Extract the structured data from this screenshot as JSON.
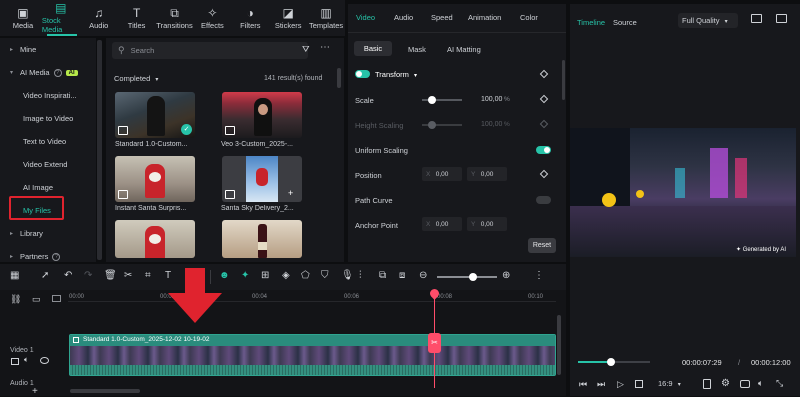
{
  "top_tabs": [
    {
      "label": "Media",
      "icon": "media-icon"
    },
    {
      "label": "Stock Media",
      "icon": "stock-media-icon"
    },
    {
      "label": "Audio",
      "icon": "audio-icon"
    },
    {
      "label": "Titles",
      "icon": "titles-icon"
    },
    {
      "label": "Transitions",
      "icon": "transitions-icon"
    },
    {
      "label": "Effects",
      "icon": "effects-icon"
    },
    {
      "label": "Filters",
      "icon": "filters-icon"
    },
    {
      "label": "Stickers",
      "icon": "stickers-icon"
    },
    {
      "label": "Templates",
      "icon": "templates-icon"
    }
  ],
  "sidebar": {
    "items": [
      {
        "label": "Mine"
      },
      {
        "label": "AI Media",
        "badge": "AI"
      },
      {
        "label": "Video Inspirati..."
      },
      {
        "label": "Image to Video"
      },
      {
        "label": "Text to Video"
      },
      {
        "label": "Video Extend"
      },
      {
        "label": "AI Image"
      },
      {
        "label": "My Files"
      },
      {
        "label": "Library"
      },
      {
        "label": "Partners"
      }
    ]
  },
  "media": {
    "search_placeholder": "Search",
    "filter_label": "Completed",
    "result_count": "141 result(s) found",
    "items": [
      {
        "label": "Standard 1.0-Custom..."
      },
      {
        "label": "Veo 3-Custom_2025-..."
      },
      {
        "label": "Instant Santa Surpris..."
      },
      {
        "label": "Santa Sky Delivery_2..."
      }
    ]
  },
  "props": {
    "tabs": [
      "Video",
      "Audio",
      "Speed",
      "Animation",
      "Color"
    ],
    "subtabs": [
      "Basic",
      "Mask",
      "AI Matting"
    ],
    "transform_label": "Transform",
    "scale_label": "Scale",
    "scale_value": "100,00",
    "scale_unit": "%",
    "height_scaling_label": "Height Scaling",
    "height_scaling_value": "100,00",
    "height_scaling_unit": "%",
    "uniform_scaling_label": "Uniform Scaling",
    "position_label": "Position",
    "position_x_label": "X",
    "position_x": "0,00",
    "position_y_label": "Y",
    "position_y": "0,00",
    "path_curve_label": "Path Curve",
    "anchor_point_label": "Anchor Point",
    "anchor_x_label": "X",
    "anchor_x": "0,00",
    "anchor_y_label": "Y",
    "anchor_y": "0,00",
    "reset_label": "Reset"
  },
  "preview": {
    "tab_timeline": "Timeline",
    "tab_source": "Source",
    "quality": "Full Quality",
    "watermark": "Generated by AI",
    "current_time": "00:00:07:29",
    "separator": "/",
    "total_time": "00:00:12:00",
    "aspect": "16:9",
    "progress": 0.46
  },
  "timeline": {
    "ruler": [
      "00:00",
      "00:02",
      "00:04",
      "00:06",
      "00:08",
      "00:10"
    ],
    "track_video": "Video 1",
    "track_audio": "Audio 1",
    "clip_label": "Standard 1.0-Custom_2025-12-02 10-19-02",
    "zoom_level": 0.6
  },
  "colors": {
    "accent": "#27c3a8",
    "highlight": "#e0232e",
    "playhead": "#ff4d6a"
  }
}
